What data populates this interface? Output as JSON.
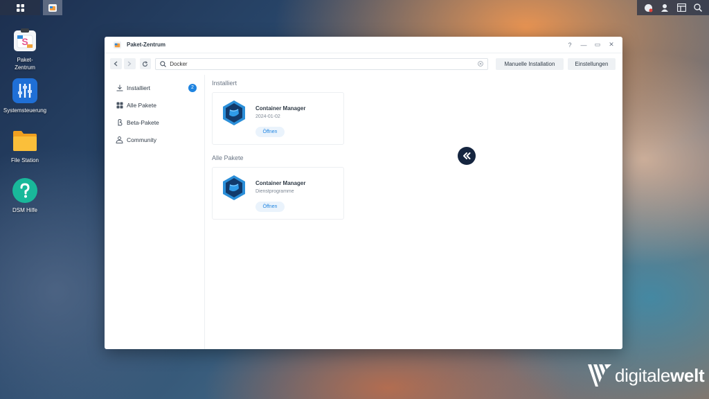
{
  "desktop": {
    "icons": [
      {
        "label_line1": "Paket-",
        "label_line2": "Zentrum"
      },
      {
        "label_line1": "Systemsteuerung",
        "label_line2": ""
      },
      {
        "label_line1": "File Station",
        "label_line2": ""
      },
      {
        "label_line1": "DSM Hilfe",
        "label_line2": ""
      }
    ]
  },
  "window": {
    "title": "Paket-Zentrum",
    "controls": {
      "help": "?",
      "minimize": "—",
      "maximize": "▭",
      "close": "✕"
    }
  },
  "toolbar": {
    "search_value": "Docker",
    "manual_install_label": "Manuelle Installation",
    "settings_label": "Einstellungen"
  },
  "sidebar": {
    "items": [
      {
        "label": "Installiert",
        "badge": "2"
      },
      {
        "label": "Alle Pakete"
      },
      {
        "label": "Beta-Pakete"
      },
      {
        "label": "Community"
      }
    ]
  },
  "main": {
    "installed_title": "Installiert",
    "installed_card": {
      "name": "Container Manager",
      "subtitle": "2024-01-02",
      "button": "Öffnen"
    },
    "all_title": "Alle Pakete",
    "all_card": {
      "name": "Container Manager",
      "subtitle": "Dienstprogramme",
      "button": "Öffnen"
    }
  },
  "watermark": {
    "part1": "digitale",
    "part2": "welt"
  },
  "colors": {
    "accent": "#1f84e0",
    "badge": "#1f84e0",
    "collapse_button": "#15253f"
  }
}
